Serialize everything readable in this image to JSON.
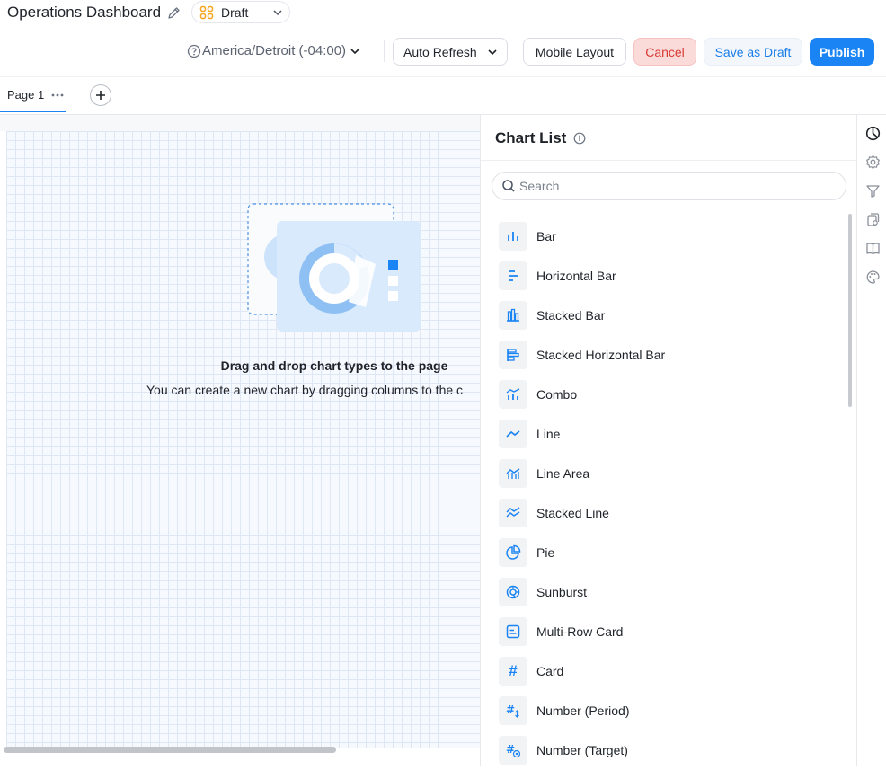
{
  "header": {
    "title": "Operations Dashboard",
    "status": "Draft",
    "timezone": "America/Detroit (-04:00)",
    "auto_refresh": "Auto Refresh",
    "mobile_layout": "Mobile Layout",
    "cancel": "Cancel",
    "save_draft": "Save as Draft",
    "publish": "Publish"
  },
  "tabs": [
    {
      "label": "Page 1"
    }
  ],
  "canvas": {
    "empty_title": "Drag and drop chart types to the page",
    "empty_subtitle": "You can create a new chart by dragging columns to the c"
  },
  "chart_list": {
    "title": "Chart List",
    "search_placeholder": "Search",
    "items": [
      {
        "label": "Bar",
        "icon": "bar-chart-icon"
      },
      {
        "label": "Horizontal Bar",
        "icon": "horizontal-bar-icon"
      },
      {
        "label": "Stacked Bar",
        "icon": "stacked-bar-icon"
      },
      {
        "label": "Stacked Horizontal Bar",
        "icon": "stacked-horizontal-bar-icon"
      },
      {
        "label": "Combo",
        "icon": "combo-chart-icon"
      },
      {
        "label": "Line",
        "icon": "line-chart-icon"
      },
      {
        "label": "Line Area",
        "icon": "line-area-icon"
      },
      {
        "label": "Stacked Line",
        "icon": "stacked-line-icon"
      },
      {
        "label": "Pie",
        "icon": "pie-chart-icon"
      },
      {
        "label": "Sunburst",
        "icon": "sunburst-icon"
      },
      {
        "label": "Multi-Row Card",
        "icon": "multi-row-card-icon"
      },
      {
        "label": "Card",
        "icon": "card-hash-icon"
      },
      {
        "label": "Number (Period)",
        "icon": "number-period-icon"
      },
      {
        "label": "Number (Target)",
        "icon": "number-target-icon"
      }
    ]
  },
  "rail": [
    "chart-list-icon",
    "settings-icon",
    "filter-icon",
    "data-source-icon",
    "book-icon",
    "palette-icon"
  ],
  "colors": {
    "accent": "#1a84f5",
    "cancel_bg": "#fbdada",
    "cancel_text": "#d93a34",
    "draft_badge": "#f5a623"
  }
}
